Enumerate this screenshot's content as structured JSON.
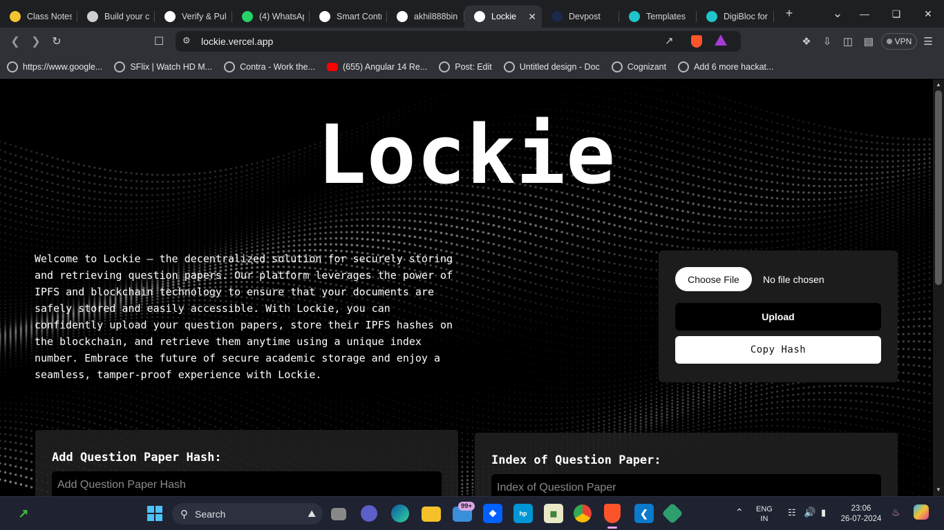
{
  "tabs": [
    {
      "title": "Class Notes",
      "icon": "pencil-icon",
      "color": "#f4c430"
    },
    {
      "title": "Build your c",
      "icon": "horse-icon",
      "color": "#cfcfcf"
    },
    {
      "title": "Verify & Pul",
      "icon": "chart-icon",
      "color": "#ffffff"
    },
    {
      "title": "(4) WhatsAp",
      "icon": "whatsapp-icon",
      "color": "#25d366"
    },
    {
      "title": "Smart Contr",
      "icon": "chatgpt-icon",
      "color": "#ffffff"
    },
    {
      "title": "akhil888bin",
      "icon": "github-icon",
      "color": "#ffffff"
    },
    {
      "title": "Lockie",
      "icon": "vercel-icon",
      "color": "#ffffff",
      "active": true
    },
    {
      "title": "Devpost",
      "icon": "devpost-icon",
      "color": "#1b2a4a"
    },
    {
      "title": "Templates",
      "icon": "canva-icon",
      "color": "#20c4cb"
    },
    {
      "title": "DigiBloc for",
      "icon": "canva-icon",
      "color": "#20c4cb"
    }
  ],
  "browser": {
    "url": "lockie.vercel.app",
    "vpn_label": "VPN",
    "new_tab": "+",
    "close_tab": "✕"
  },
  "bookmarks": [
    {
      "label": "https://www.google...",
      "icon": "globe-icon"
    },
    {
      "label": "SFlix | Watch HD M...",
      "icon": "globe-icon"
    },
    {
      "label": "Contra - Work the...",
      "icon": "globe-icon"
    },
    {
      "label": "(655) Angular 14 Re...",
      "icon": "youtube-icon"
    },
    {
      "label": "Post: Edit",
      "icon": "globe-icon"
    },
    {
      "label": "Untitled design - Doc",
      "icon": "globe-icon"
    },
    {
      "label": "Cognizant",
      "icon": "globe-icon"
    },
    {
      "label": "Add 6 more hackat...",
      "icon": "globe-icon"
    }
  ],
  "page": {
    "title": "Lockie",
    "intro": "Welcome to Lockie – the decentralized solution for securely storing and retrieving question papers. Our platform leverages the power of IPFS and blockchain technology to ensure that your documents are safely stored and easily accessible. With Lockie, you can confidently upload your question papers, store their IPFS hashes on the blockchain, and retrieve them anytime using a unique index number. Embrace the future of secure academic storage and enjoy a seamless, tamper-proof experience with Lockie.",
    "upload": {
      "choose_file": "Choose File",
      "no_file": "No file chosen",
      "upload_btn": "Upload",
      "copy_btn": "Copy Hash"
    },
    "add_hash": {
      "label": "Add Question Paper Hash:",
      "placeholder": "Add Question Paper Hash"
    },
    "index": {
      "label": "Index of Question Paper:",
      "placeholder": "Index of Question Paper"
    }
  },
  "taskbar": {
    "search": "Search",
    "mail_badge": "99+",
    "lang_top": "ENG",
    "lang_bottom": "IN",
    "time": "23:06",
    "date": "26-07-2024"
  }
}
